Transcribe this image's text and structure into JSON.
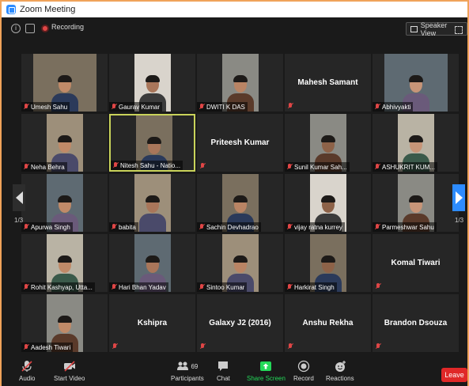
{
  "window": {
    "title": "Zoom Meeting"
  },
  "header": {
    "recording_label": "Recording",
    "view_label": "Speaker View"
  },
  "pagination": {
    "left_page": "1/3",
    "right_page": "1/3"
  },
  "participants": [
    {
      "name": "Umesh Sahu",
      "video": true
    },
    {
      "name": "Gaurav Kumar",
      "video": true
    },
    {
      "name": "DWITI K DAS",
      "video": true
    },
    {
      "name": "Mahesh Samant",
      "video": false
    },
    {
      "name": "Abhivyakti",
      "video": true
    },
    {
      "name": "Neha Behra",
      "video": true
    },
    {
      "name": "Nitesh Sahu - Natio...",
      "video": true,
      "active": true
    },
    {
      "name": "Priteesh Kumar",
      "video": false
    },
    {
      "name": "Sunil Kumar Sah...",
      "video": true
    },
    {
      "name": "ASHUKRIT KUM...",
      "video": true
    },
    {
      "name": "Apurwa Singh",
      "video": true
    },
    {
      "name": "babita",
      "video": true
    },
    {
      "name": "Sachin Devhadrao",
      "video": true
    },
    {
      "name": "vijay ratna kurrey",
      "video": true
    },
    {
      "name": "Parmeshwar Sahu",
      "video": true
    },
    {
      "name": "Rohit Kashyap, Utta...",
      "video": true
    },
    {
      "name": "Hari Bhan Yadav",
      "video": true
    },
    {
      "name": "Sintoo Kumar",
      "video": true
    },
    {
      "name": "Harkirat Singh",
      "video": true
    },
    {
      "name": "Komal Tiwari",
      "video": false
    },
    {
      "name": "Aadesh Tiwari",
      "video": true
    },
    {
      "name": "Kshipra",
      "video": false
    },
    {
      "name": "Galaxy J2 (2016)",
      "video": false
    },
    {
      "name": "Anshu Rekha",
      "video": false
    },
    {
      "name": "Brandon Dsouza",
      "video": false
    }
  ],
  "toolbar": {
    "audio": "Audio",
    "start_video": "Start Video",
    "participants": "Participants",
    "participants_count": "69",
    "chat": "Chat",
    "share_screen": "Share Screen",
    "record": "Record",
    "reactions": "Reactions",
    "leave": "Leave"
  },
  "colors": {
    "accent": "#2d8cff",
    "share": "#23d959",
    "leave": "#e02828",
    "active_border": "#c9d35a"
  }
}
